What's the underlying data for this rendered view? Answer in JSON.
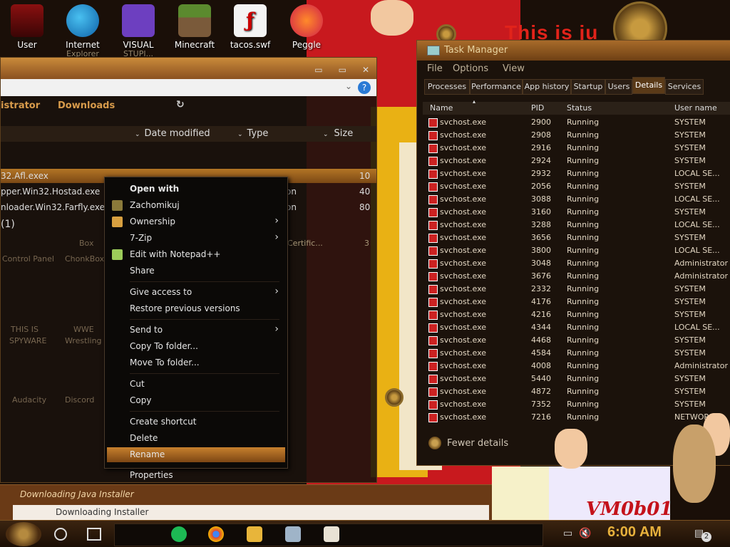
{
  "desktop": {
    "icons": [
      {
        "label": "User",
        "sub": ""
      },
      {
        "label": "Internet",
        "sub": "Explorer"
      },
      {
        "label": "VISUAL",
        "sub": "STUPI..."
      },
      {
        "label": "Minecraft",
        "sub": ""
      },
      {
        "label": "tacos.swf",
        "sub": ""
      },
      {
        "label": "Peggle",
        "sub": ""
      }
    ],
    "banner": "This is ju",
    "watermark": "VM0b01",
    "colors": {
      "accent": "#c98a3a",
      "wallpaper_red": "#c8191e"
    }
  },
  "explorer": {
    "crumbs": [
      "istrator",
      "Downloads"
    ],
    "columns": [
      "Date modified",
      "Type",
      "Size"
    ],
    "rows": [
      {
        "name": "32.Afl.exex",
        "col2": "",
        "size": "10"
      },
      {
        "name": "pper.Win32.Hostad.exe",
        "col2": "on",
        "size": "40"
      },
      {
        "name": "nloader.Win32.Farfly.exe",
        "col2": "on",
        "size": "80"
      }
    ],
    "group": "(1)",
    "ghost_labels": {
      "control_panel": "Control Panel",
      "box": "Box",
      "chonkbox": "ChonkBox",
      "spyware1": "THIS IS",
      "spyware2": "SPYWARE",
      "wwe": "WWE",
      "wrestling": "Wrestling",
      "audacity": "Audacity",
      "discord": "Discord",
      "certific": "Certific...",
      "certific_size": "3"
    }
  },
  "context_menu": {
    "items": [
      {
        "label": "Open with",
        "bold": true,
        "submenu": false,
        "icon": ""
      },
      {
        "label": "Zachomikuj",
        "submenu": false,
        "icon": "hamster-icon"
      },
      {
        "label": "Ownership",
        "submenu": true,
        "icon": "ownership-icon"
      },
      {
        "label": "7-Zip",
        "submenu": true,
        "icon": ""
      },
      {
        "label": "Edit with Notepad++",
        "submenu": false,
        "icon": "notepad-icon"
      },
      {
        "label": "Share",
        "submenu": false,
        "icon": ""
      },
      {
        "label": "Give access to",
        "submenu": true,
        "icon": ""
      },
      {
        "label": "Restore previous versions",
        "submenu": false,
        "icon": ""
      },
      {
        "label": "Send to",
        "submenu": true,
        "icon": ""
      },
      {
        "label": "Copy To folder...",
        "submenu": false,
        "icon": ""
      },
      {
        "label": "Move To folder...",
        "submenu": false,
        "icon": ""
      },
      {
        "label": "Cut",
        "submenu": false,
        "icon": ""
      },
      {
        "label": "Copy",
        "submenu": false,
        "icon": ""
      },
      {
        "label": "Create shortcut",
        "submenu": false,
        "icon": ""
      },
      {
        "label": "Delete",
        "submenu": false,
        "icon": ""
      },
      {
        "label": "Rename",
        "submenu": false,
        "icon": "",
        "highlighted": true
      },
      {
        "label": "Properties",
        "submenu": false,
        "icon": ""
      }
    ]
  },
  "task_manager": {
    "title": "Task Manager",
    "menu": [
      "File",
      "Options",
      "View"
    ],
    "tabs": [
      "Processes",
      "Performance",
      "App history",
      "Startup",
      "Users",
      "Details",
      "Services"
    ],
    "active_tab": "Details",
    "columns": [
      "Name",
      "PID",
      "Status",
      "User name"
    ],
    "rows": [
      {
        "name": "svchost.exe",
        "pid": "2900",
        "status": "Running",
        "user": "SYSTEM"
      },
      {
        "name": "svchost.exe",
        "pid": "2908",
        "status": "Running",
        "user": "SYSTEM"
      },
      {
        "name": "svchost.exe",
        "pid": "2916",
        "status": "Running",
        "user": "SYSTEM"
      },
      {
        "name": "svchost.exe",
        "pid": "2924",
        "status": "Running",
        "user": "SYSTEM"
      },
      {
        "name": "svchost.exe",
        "pid": "2932",
        "status": "Running",
        "user": "LOCAL SE..."
      },
      {
        "name": "svchost.exe",
        "pid": "2056",
        "status": "Running",
        "user": "SYSTEM"
      },
      {
        "name": "svchost.exe",
        "pid": "3088",
        "status": "Running",
        "user": "LOCAL SE..."
      },
      {
        "name": "svchost.exe",
        "pid": "3160",
        "status": "Running",
        "user": "SYSTEM"
      },
      {
        "name": "svchost.exe",
        "pid": "3288",
        "status": "Running",
        "user": "LOCAL SE..."
      },
      {
        "name": "svchost.exe",
        "pid": "3656",
        "status": "Running",
        "user": "SYSTEM"
      },
      {
        "name": "svchost.exe",
        "pid": "3800",
        "status": "Running",
        "user": "LOCAL SE..."
      },
      {
        "name": "svchost.exe",
        "pid": "3048",
        "status": "Running",
        "user": "Administrator"
      },
      {
        "name": "svchost.exe",
        "pid": "3676",
        "status": "Running",
        "user": "Administrator"
      },
      {
        "name": "svchost.exe",
        "pid": "2332",
        "status": "Running",
        "user": "SYSTEM"
      },
      {
        "name": "svchost.exe",
        "pid": "4176",
        "status": "Running",
        "user": "SYSTEM"
      },
      {
        "name": "svchost.exe",
        "pid": "4216",
        "status": "Running",
        "user": "SYSTEM"
      },
      {
        "name": "svchost.exe",
        "pid": "4344",
        "status": "Running",
        "user": "LOCAL SE..."
      },
      {
        "name": "svchost.exe",
        "pid": "4468",
        "status": "Running",
        "user": "SYSTEM"
      },
      {
        "name": "svchost.exe",
        "pid": "4584",
        "status": "Running",
        "user": "SYSTEM"
      },
      {
        "name": "svchost.exe",
        "pid": "4008",
        "status": "Running",
        "user": "Administrator"
      },
      {
        "name": "svchost.exe",
        "pid": "5440",
        "status": "Running",
        "user": "SYSTEM"
      },
      {
        "name": "svchost.exe",
        "pid": "4872",
        "status": "Running",
        "user": "SYSTEM"
      },
      {
        "name": "svchost.exe",
        "pid": "7352",
        "status": "Running",
        "user": "SYSTEM"
      },
      {
        "name": "svchost.exe",
        "pid": "7216",
        "status": "Running",
        "user": "NETWORK..."
      }
    ],
    "fewer_details": "Fewer details"
  },
  "installer": {
    "title": "Downloading Java Installer",
    "body": "Downloading Installer"
  },
  "taskbar": {
    "clock": "6:00 AM",
    "notification_count": "2"
  }
}
